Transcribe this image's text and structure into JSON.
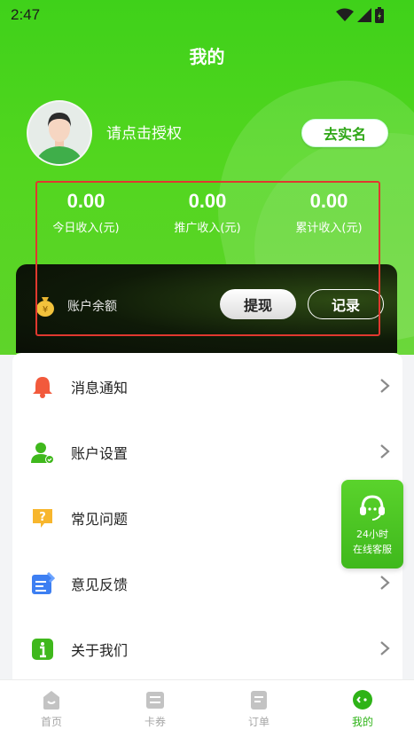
{
  "status_bar": {
    "time": "2:47"
  },
  "header": {
    "title": "我的"
  },
  "profile": {
    "auth_prompt": "请点击授权",
    "realname_button": "去实名"
  },
  "stats": [
    {
      "value": "0.00",
      "label": "今日收入(元)"
    },
    {
      "value": "0.00",
      "label": "推广收入(元)"
    },
    {
      "value": "0.00",
      "label": "累计收入(元)"
    }
  ],
  "balance": {
    "label": "账户余额",
    "withdraw_button": "提现",
    "record_button": "记录"
  },
  "menu": [
    {
      "label": "消息通知",
      "icon": "bell-icon"
    },
    {
      "label": "账户设置",
      "icon": "user-settings-icon"
    },
    {
      "label": "常见问题",
      "icon": "question-icon"
    },
    {
      "label": "意见反馈",
      "icon": "feedback-icon"
    },
    {
      "label": "关于我们",
      "icon": "info-icon"
    }
  ],
  "service": {
    "line1": "24小时",
    "line2": "在线客服"
  },
  "tabbar": [
    {
      "label": "首页",
      "icon": "home-icon"
    },
    {
      "label": "卡券",
      "icon": "coupon-icon"
    },
    {
      "label": "订单",
      "icon": "order-icon"
    },
    {
      "label": "我的",
      "icon": "mine-icon"
    }
  ],
  "colors": {
    "brand_green": "#3fd11a",
    "active_tab": "#2eb317",
    "highlight_border": "#e0382f"
  }
}
